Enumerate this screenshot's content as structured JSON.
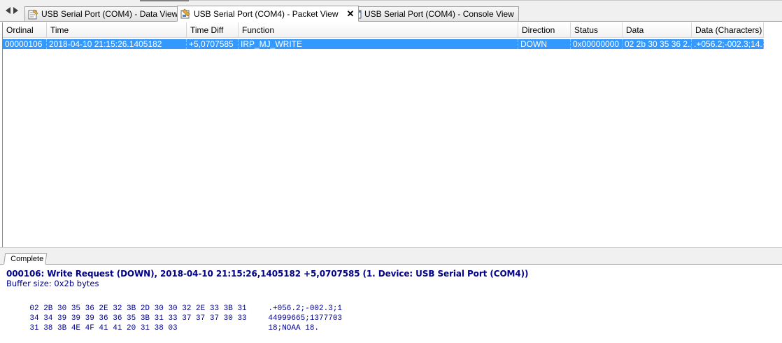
{
  "tabs": [
    {
      "label": "USB Serial Port (COM4) - Data View",
      "icon": "data-view-icon",
      "active": false
    },
    {
      "label": "USB Serial Port (COM4) - Packet View",
      "icon": "packet-view-icon",
      "active": true,
      "close": "✕"
    },
    {
      "label": "USB Serial Port (COM4) - Console View",
      "icon": "console-view-icon",
      "active": false
    }
  ],
  "grid": {
    "columns": [
      "Ordinal",
      "Time",
      "Time Diff",
      "Function",
      "Direction",
      "Status",
      "Data",
      "Data (Characters)"
    ],
    "rows": [
      {
        "ordinal": "00000106",
        "time": "2018-04-10 21:15:26.1405182",
        "time_diff": "+5,0707585",
        "function": "IRP_MJ_WRITE",
        "direction": "DOWN",
        "status": "0x00000000",
        "data": "02 2b 30 35 36 2...",
        "data_chars": ".+056.2;-002.3;14..."
      }
    ]
  },
  "bottom_tab": {
    "label": "Complete"
  },
  "detail": {
    "title": "000106: Write Request (DOWN), 2018-04-10 21:15:26,1405182 +5,0707585 (1. Device: USB Serial Port (COM4))",
    "buffer": "Buffer size: 0x2b bytes",
    "dump": [
      {
        "hex": "02 2B 30 35 36 2E 32 3B 2D 30 30 32 2E 33 3B 31",
        "ascii": ".+056.2;-002.3;1"
      },
      {
        "hex": "34 34 39 39 39 36 36 35 3B 31 33 37 37 37 30 33",
        "ascii": "44999665;1377703"
      },
      {
        "hex": "31 38 3B 4E 4F 41 41 20 31 38 03",
        "ascii": "18;NOAA 18."
      }
    ]
  },
  "colors": {
    "selection": "#3399ff",
    "detail_text": "#00008b"
  }
}
